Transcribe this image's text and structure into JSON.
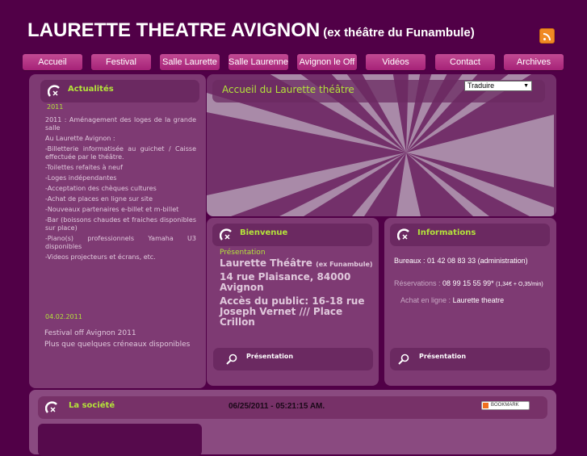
{
  "header": {
    "title": "LAURETTE THEATRE AVIGNON",
    "subtitle": "(ex théâtre du Funambule)",
    "rss_icon": "rss-icon"
  },
  "nav": [
    "Accueil",
    "Festival",
    "Salle Laurette",
    "Salle Laurenne",
    "Avignon le Off",
    "Vidéos",
    "Contact",
    "Archives"
  ],
  "actualites": {
    "title": "Actualités",
    "year": "2011",
    "items": [
      "2011 : Aménagement des loges de la grande salle",
      "Au Laurette Avignon :",
      "-Billetterie informatisée au guichet / Caisse effectuée par le théâtre.",
      "-Toilettes refaites à neuf",
      "-Loges indépendantes",
      "-Acceptation des chèques cultures",
      "-Achat de places en ligne sur site",
      "-Nouveaux partenaires e-billet et m-billet",
      "-Bar (boissons chaudes et fraiches disponibles sur place)",
      "-Piano(s) professionnels Yamaha U3 disponibles",
      "-Videos projecteurs et écrans, etc."
    ],
    "date2": "04.02.2011",
    "news2": [
      "Festival off Avignon 2011",
      "Plus que quelques créneaux disponibles"
    ]
  },
  "main": {
    "title": "Accueil du Laurette théâtre",
    "translate": "Traduire"
  },
  "bienvenue": {
    "title": "Bienvenue",
    "sub": "Présentation",
    "name": "Laurette Théâtre",
    "name_note": "(ex Funambule)",
    "address": "14 rue Plaisance, 84000 Avignon",
    "access": "Accès du public: 16-18 rue Joseph Vernet /// Place Crillon",
    "link": "Présentation"
  },
  "informations": {
    "title": "Informations",
    "bureaux": "Bureaux : 01 42 08 83 33 (administration)",
    "res_label": "Réservations :",
    "res_number": "08 99 15 55 99*",
    "res_price": "(1,34€ + O,35/min)",
    "achat_label": "Achat en ligne :",
    "achat_link": "Laurette theatre",
    "link": "Présentation"
  },
  "societe": {
    "title": "La société",
    "datetime": "06/25/2011 - 05:21:15 AM.",
    "bookmark": "BOOKMARK"
  },
  "colors": {
    "bg": "#510047",
    "accent": "#b4e43a",
    "nav": "#b0307f"
  }
}
